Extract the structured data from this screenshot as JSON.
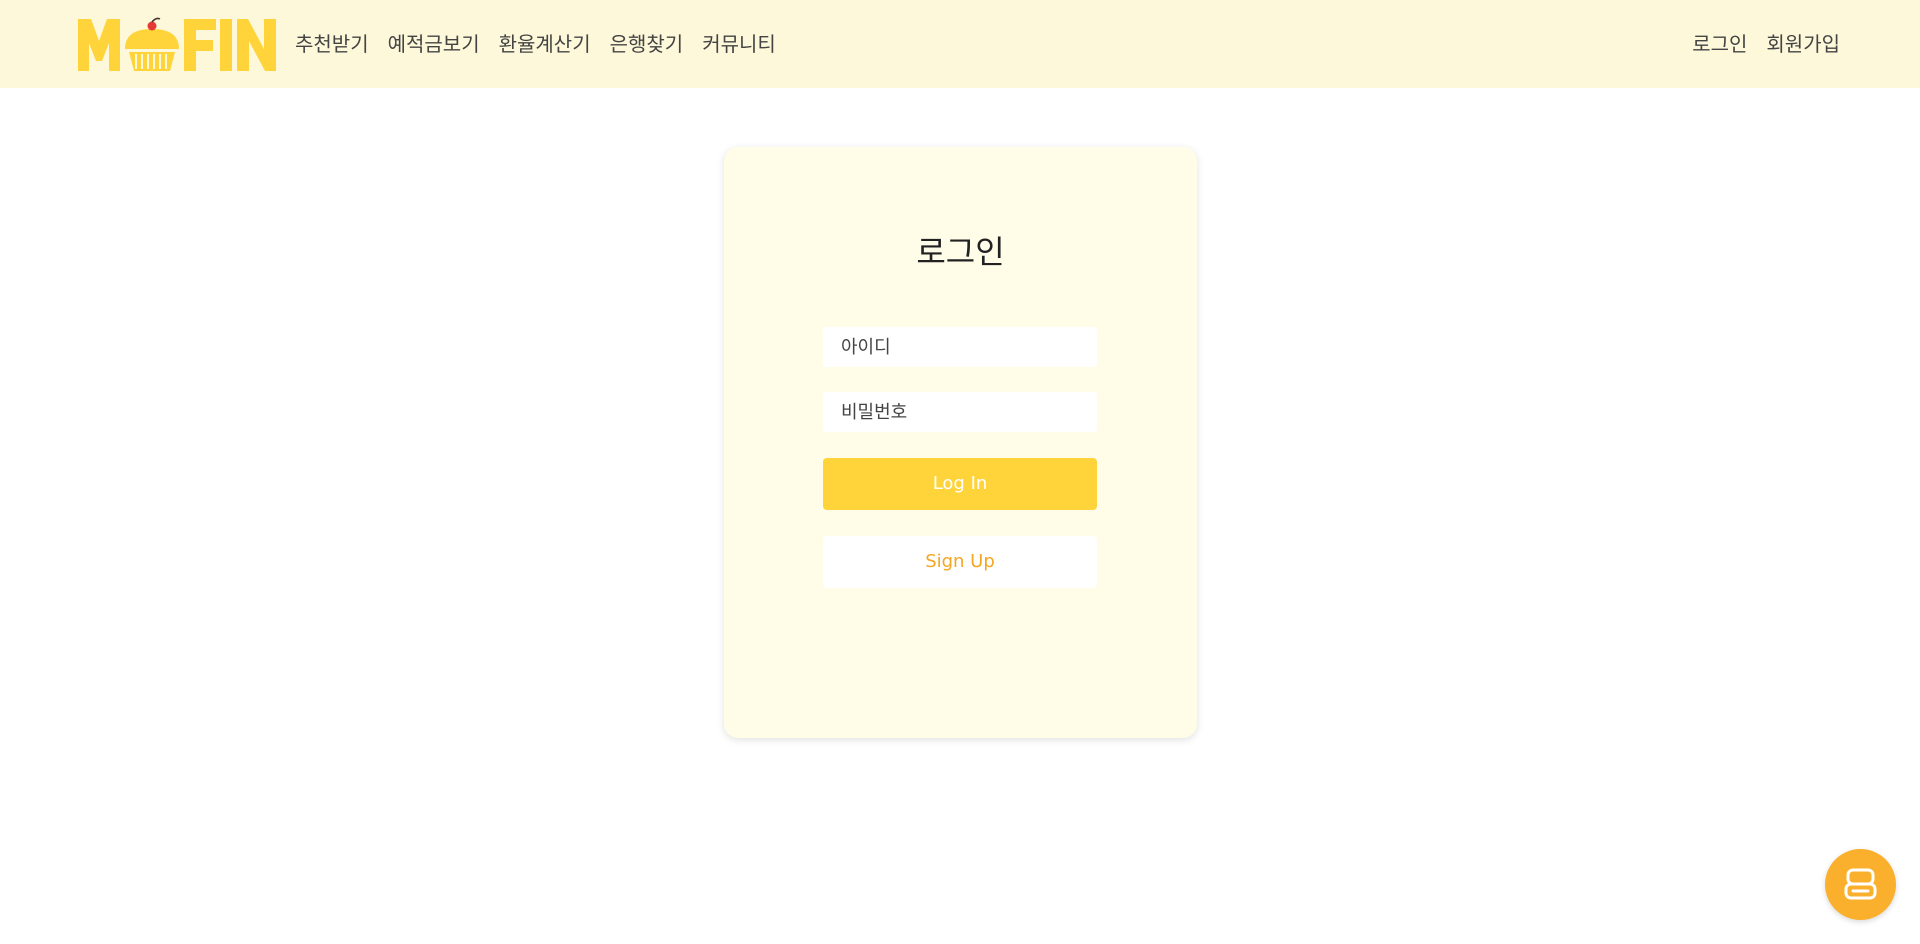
{
  "header": {
    "logo_text": "MUFIN",
    "nav": [
      {
        "label": "추천받기"
      },
      {
        "label": "예적금보기"
      },
      {
        "label": "환율계산기"
      },
      {
        "label": "은행찾기"
      },
      {
        "label": "커뮤니티"
      }
    ],
    "auth": {
      "login_label": "로그인",
      "signup_label": "회원가입"
    }
  },
  "login_card": {
    "title": "로그인",
    "id_placeholder": "아이디",
    "password_placeholder": "비밀번호",
    "login_button_label": "Log In",
    "signup_button_label": "Sign Up"
  },
  "chat_fab": {
    "icon": "robot-icon"
  },
  "colors": {
    "header_bg": "#fdf8d9",
    "card_bg": "#fffde8",
    "brand_yellow": "#ffd43b",
    "signup_text": "#f5a623",
    "fab_orange": "#fbb02d"
  }
}
